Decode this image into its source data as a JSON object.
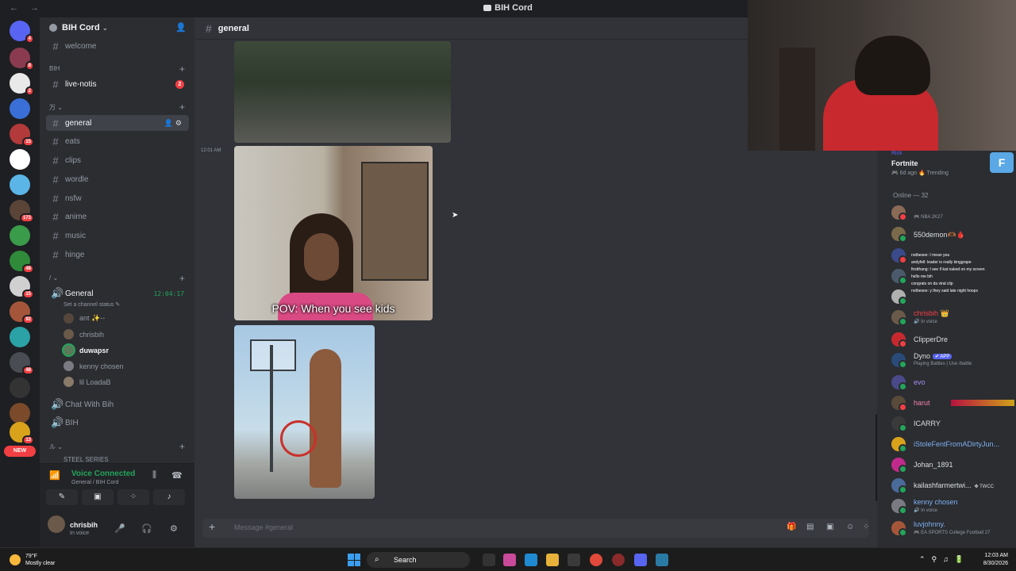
{
  "window": {
    "title": "BIH Cord"
  },
  "servers": {
    "badges": [
      "4",
      "8",
      "2",
      "15",
      "15",
      "173",
      "48",
      "15",
      "92",
      "48",
      "13"
    ],
    "new_label": "NEW"
  },
  "sidebar": {
    "guild_name": "BIH Cord",
    "top_channel": "welcome",
    "cat_bih": "BIH",
    "live_notis": {
      "label": "live-notis",
      "badge": "2"
    },
    "cat_two": "万 ⌄",
    "channels": [
      "general",
      "eats",
      "clips",
      "wordle",
      "nsfw",
      "anime",
      "music",
      "hinge"
    ],
    "cat_three": "/ ⌄",
    "voice_general": {
      "label": "General",
      "timer": "12:04:17",
      "status": "Set a channel status ✎"
    },
    "voice_users": [
      "ant ✨--",
      "chrisbih",
      "duwapsr",
      "kenny chosen",
      "lil LoadaB"
    ],
    "voice_chat_with": "Chat With Bih",
    "voice_bih": "BIH",
    "cat_four": "ル ⌄",
    "steel": "STEEL SERIES"
  },
  "voicepanel": {
    "title": "Voice Connected",
    "sub": "General / BIH Cord"
  },
  "user": {
    "name": "chrisbih",
    "status": "In voice"
  },
  "channel": {
    "name": "general"
  },
  "messages": {
    "timestamp": "12:01 AM",
    "caption": "POV: When you see kids"
  },
  "composer": {
    "placeholder": "Message #general"
  },
  "activity": {
    "who": "Rick",
    "game": "Fortnite",
    "meta": "🎮 6d ago  🔥 Trending",
    "icon": "F"
  },
  "members": {
    "header": "Online — 32",
    "list": [
      {
        "name": "",
        "status": "🎮 NBA 2K27"
      },
      {
        "name": "550demon🫶🏾🩸",
        "status": ""
      },
      {
        "name": "",
        "status": ""
      },
      {
        "name": "",
        "status": ""
      },
      {
        "name": "",
        "status": ""
      },
      {
        "name": "chrisbih 👑",
        "status": "🔊 In voice"
      },
      {
        "name": "ClipperDre",
        "status": ""
      },
      {
        "name": "Dyno",
        "status": "Playing Battles | Use /battle"
      },
      {
        "name": "evo",
        "status": ""
      },
      {
        "name": "harut",
        "status": ""
      },
      {
        "name": "ICARRY",
        "status": ""
      },
      {
        "name": "iStoleFentFromADirtyJun...",
        "status": ""
      },
      {
        "name": "Johan_1891",
        "status": ""
      },
      {
        "name": "kailashfarmertwi...",
        "status": ""
      },
      {
        "name": "kenny chosen",
        "status": "🔊 In voice"
      },
      {
        "name": "luvjohnny.",
        "status": "🎮 EA SPORTS College Football 27"
      }
    ],
    "dyno_tag": "✔ APP",
    "kailash_tag": "✤ TWCC"
  },
  "chat_overlay": [
    "notbesee: I mean yea",
    "andyfell: leader is really kinggrape",
    "firstthang: I see if kat naked on my screen",
    "hello me bih",
    "congrats on da viral clip",
    "notbesee: y they said late night hoops"
  ],
  "taskbar": {
    "weather_temp": "79°F",
    "weather_desc": "Mostly clear",
    "search": "Search",
    "time": "12:03 AM",
    "date": "8/30/2026"
  },
  "colors": {
    "accent": "#5865f2",
    "online": "#23a55a",
    "danger": "#f23f43"
  }
}
